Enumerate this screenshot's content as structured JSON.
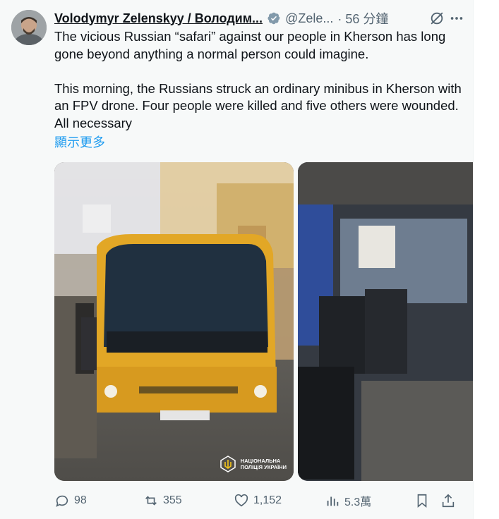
{
  "tweet": {
    "author_name": "Volodymyr Zelenskyy / Володим...",
    "handle": "@Zele...",
    "time": "· 56 分鐘",
    "paragraph1": "The vicious Russian “safari” against our people in Kherson has long gone beyond anything a normal person could imagine.",
    "paragraph2": "This morning, the Russians struck an ordinary minibus in Kherson with an FPV drone. Four people were killed and five others were wounded. All necessary",
    "show_more": "顯示更多",
    "watermark_line1": "НАЦІОНАЛЬНА",
    "watermark_line2": "ПОЛІЦІЯ УКРАЇНИ",
    "photo2_placeholder": ""
  },
  "stats": {
    "replies": "98",
    "reposts": "355",
    "likes": "1,152",
    "views": "5.3萬"
  },
  "colors": {
    "accent": "#1d9bf0",
    "muted": "#536471",
    "text": "#0f1419",
    "background": "#f7f9f9"
  },
  "icons": [
    "verified-badge-icon",
    "grok-icon",
    "more-icon",
    "reply-icon",
    "repost-icon",
    "like-icon",
    "views-icon",
    "bookmark-icon",
    "share-icon"
  ]
}
